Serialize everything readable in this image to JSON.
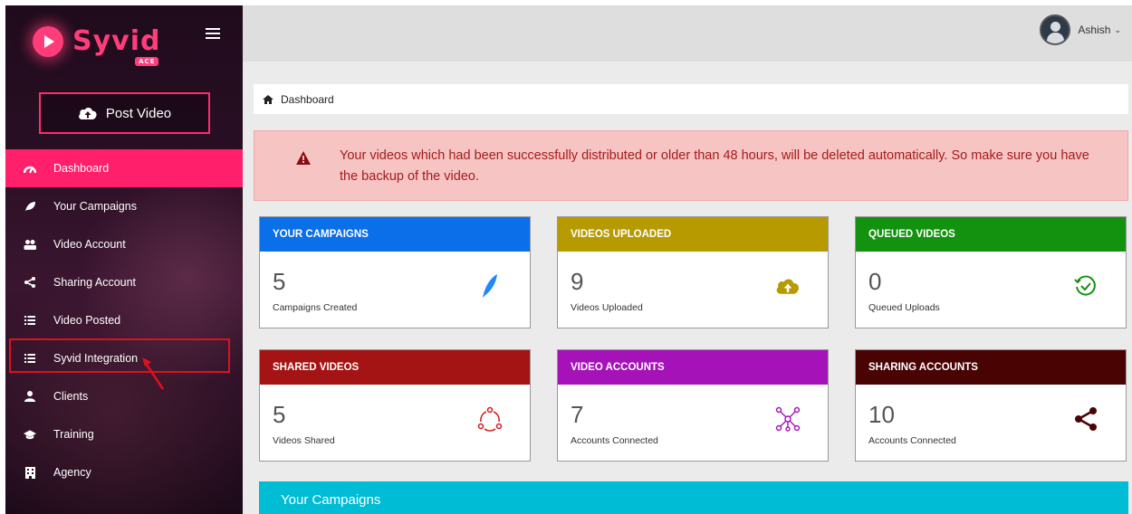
{
  "brand": {
    "name": "Syvid",
    "badge": "ACE"
  },
  "sidebar": {
    "post_button": "Post Video",
    "items": [
      {
        "label": "Dashboard",
        "icon": "gauge-icon",
        "active": true
      },
      {
        "label": "Your Campaigns",
        "icon": "leaf-icon"
      },
      {
        "label": "Video Account",
        "icon": "users-icon"
      },
      {
        "label": "Sharing Account",
        "icon": "share-icon"
      },
      {
        "label": "Video Posted",
        "icon": "list-icon"
      },
      {
        "label": "Syvid Integration",
        "icon": "list-icon"
      },
      {
        "label": "Clients",
        "icon": "user-icon"
      },
      {
        "label": "Training",
        "icon": "graduation-cap-icon"
      },
      {
        "label": "Agency",
        "icon": "building-icon"
      }
    ]
  },
  "header": {
    "user_name": "Ashish"
  },
  "breadcrumb": {
    "label": "Dashboard"
  },
  "alert": {
    "message": "Your videos which had been successfully distributed or older than 48 hours, will be deleted automatically. So make sure you have the backup of the video."
  },
  "cards": [
    {
      "title": "YOUR CAMPAIGNS",
      "value": "5",
      "caption": "Campaigns Created",
      "color": "#0a6fe8",
      "icon": "feather-icon",
      "icon_color": "#1e88ff"
    },
    {
      "title": "VIDEOS UPLOADED",
      "value": "9",
      "caption": "Videos Uploaded",
      "color": "#b79a00",
      "icon": "cloud-upload-icon",
      "icon_color": "#b79a00"
    },
    {
      "title": "QUEUED VIDEOS",
      "value": "0",
      "caption": "Queued Uploads",
      "color": "#13920f",
      "icon": "clock-check-icon",
      "icon_color": "#13920f"
    },
    {
      "title": "SHARED VIDEOS",
      "value": "5",
      "caption": "Videos Shared",
      "color": "#a51414",
      "icon": "share-cycle-icon",
      "icon_color": "#d11a1a"
    },
    {
      "title": "VIDEO ACCOUNTS",
      "value": "7",
      "caption": "Accounts Connected",
      "color": "#a412b8",
      "icon": "network-icon",
      "icon_color": "#a412b8"
    },
    {
      "title": "SHARING ACCOUNTS",
      "value": "10",
      "caption": "Accounts Connected",
      "color": "#4a0303",
      "icon": "share-icon",
      "icon_color": "#4a0303"
    }
  ],
  "section": {
    "title": "Your Campaigns"
  }
}
